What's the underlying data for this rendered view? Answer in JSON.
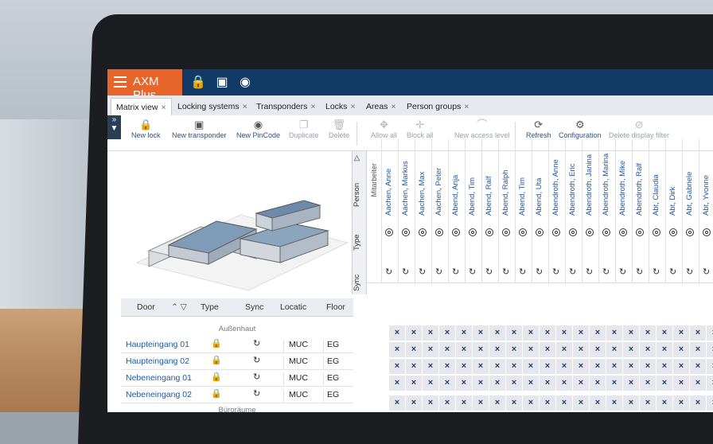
{
  "app": {
    "title": "AXM Plus"
  },
  "tabs": [
    {
      "label": "Matrix view",
      "close": "×"
    },
    {
      "label": "Locking systems",
      "close": "×"
    },
    {
      "label": "Transponders",
      "close": "×"
    },
    {
      "label": "Locks",
      "close": "×"
    },
    {
      "label": "Areas",
      "close": "×"
    },
    {
      "label": "Person groups",
      "close": "×"
    }
  ],
  "toolbar": {
    "new_lock": "New lock",
    "new_transponder": "New transponder",
    "new_pincode": "New PinCode",
    "duplicate": "Duplicate",
    "delete": "Delete",
    "allow_all": "Allow all",
    "block_all": "Block all",
    "new_access_level": "New access level",
    "refresh": "Refresh",
    "configuration": "Configuration",
    "delete_display_filter": "Delete display filter"
  },
  "vertical_tabs": {
    "person": "Person",
    "type": "Type",
    "sync": "Sync",
    "employees": "Mitarbeiter"
  },
  "persons": [
    "Aachen, Anne",
    "Aachen, Markus",
    "Aachen, Max",
    "Aachen, Peter",
    "Abend, Anja",
    "Abend, Tim",
    "Abend, Ralf",
    "Abend, Ralph",
    "Abend, Tim",
    "Abend, Uta",
    "Abendroth, Anne",
    "Abendroth, Eric",
    "Abendroth, Janina",
    "Abendroth, Marina",
    "Abendroth, Mike",
    "Abendroth, Ralf",
    "Abt, Claudia",
    "Abt, Dirk",
    "Abt, Gabriele",
    "Abt, Yvonne"
  ],
  "door_table": {
    "headers": {
      "door": "Door",
      "type": "Type",
      "sync": "Sync",
      "location": "Locatic",
      "floor": "Floor"
    },
    "group1": "Außenhaut",
    "group2": "Büroräume",
    "rows": [
      {
        "door": "Haupteingang 01",
        "location": "MUC",
        "floor": "EG"
      },
      {
        "door": "Haupteingang 02",
        "location": "MUC",
        "floor": "EG"
      },
      {
        "door": "Nebeneingang 01",
        "location": "MUC",
        "floor": "EG"
      },
      {
        "door": "Nebeneingang 02",
        "location": "MUC",
        "floor": "EG"
      }
    ]
  },
  "matrix_symbol": "×",
  "sync_symbol": "↻",
  "colors": {
    "topbar": "#123a66",
    "brand": "#e8652b",
    "link": "#1f5aa8"
  }
}
